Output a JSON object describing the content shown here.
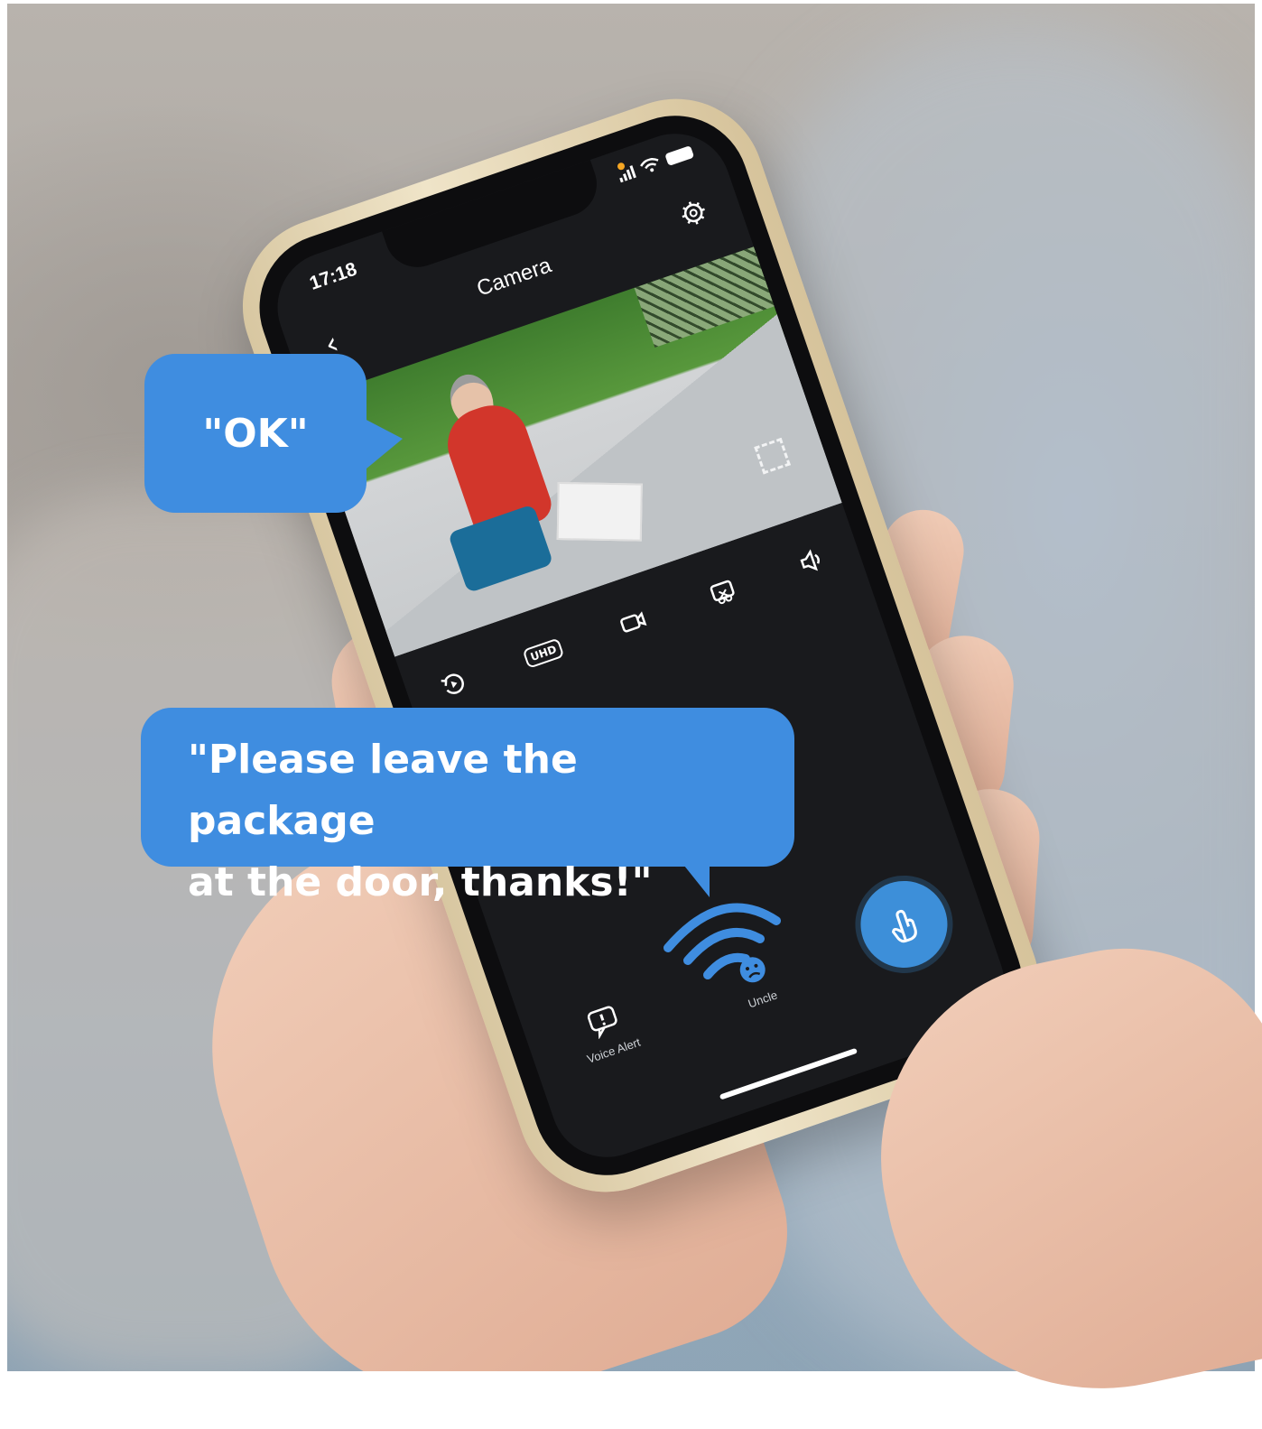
{
  "status_bar": {
    "time": "17:18"
  },
  "header": {
    "title": "Camera"
  },
  "video": {
    "overlay_text": ""
  },
  "controls": {
    "uhd_label": "UHD"
  },
  "tabs": [
    {
      "label": "Voice Alert",
      "icon": "voice-alert-icon"
    },
    {
      "label": "Uncle",
      "icon": "emoji-face-icon"
    },
    {
      "label": "",
      "icon": "talk-hand-icon"
    }
  ],
  "bubbles": {
    "ok": "\"OK\"",
    "message_line1": "\"Please leave the package",
    "message_line2": "at the door, thanks!\""
  },
  "colors": {
    "accent": "#3f8de0",
    "screen_bg": "#191a1d"
  }
}
